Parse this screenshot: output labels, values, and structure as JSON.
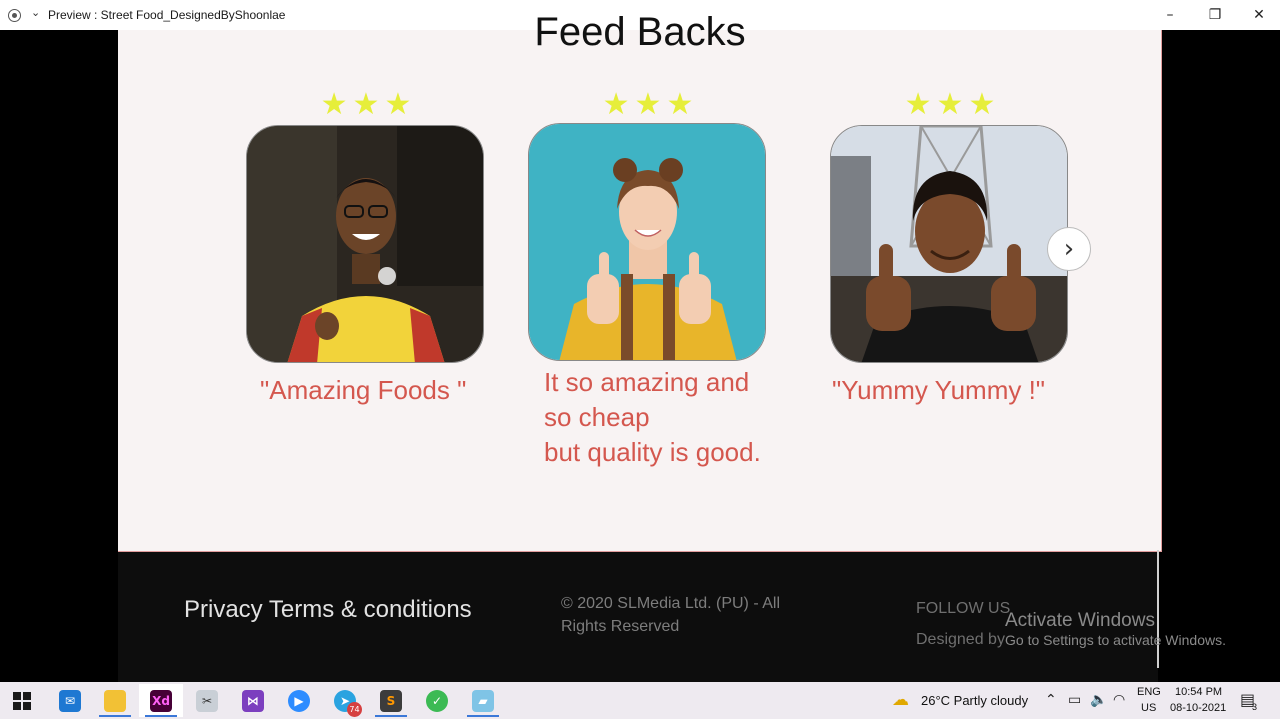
{
  "window": {
    "title": "Preview : Street Food_DesignedByShoonlae",
    "minimize": "–",
    "maximize": "❐",
    "close": "✕"
  },
  "feedback": {
    "section_title": "Feed Backs",
    "star_glyph": "★",
    "cards": [
      {
        "rating": 3,
        "quote": "\"Amazing Foods \""
      },
      {
        "rating": 3,
        "quote": "It so amazing and\nso cheap\nbut quality is good."
      },
      {
        "rating": 3,
        "quote": "\"Yummy Yummy !\""
      }
    ],
    "next_label": "›"
  },
  "footer": {
    "links": "Privacy Terms & conditions",
    "copyright": "© 2020 SLMedia Ltd. (PU) - All Rights Reserved",
    "follow": "FOLLOW US",
    "designed_by": "Designed by"
  },
  "watermark": {
    "title": "Activate Windows",
    "subtitle": "Go to Settings to activate Windows."
  },
  "taskbar": {
    "apps": [
      "start-icon",
      "mail-icon",
      "file-explorer-icon",
      "adobe-xd-icon",
      "snipping-tool-icon",
      "visual-studio-icon",
      "zoom-icon",
      "telegram-icon",
      "sublime-text-icon",
      "vpn-icon",
      "paint-icon"
    ],
    "xd_label": "Xd",
    "telegram_badge": "74",
    "weather": "26°C  Partly cloudy",
    "language": "ENG",
    "region": "US",
    "time": "10:54 PM",
    "date": "08-10-2021",
    "notifications": "3"
  },
  "colors": {
    "star": "#e6ee3a",
    "quote": "#d4574e",
    "page_bg": "#f8f3f3",
    "footer_bg": "#0d0d0d"
  }
}
